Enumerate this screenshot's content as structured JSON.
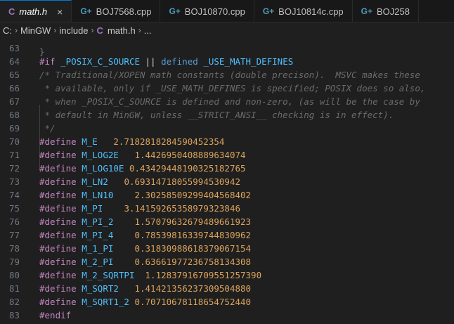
{
  "tabs": [
    {
      "icon": "C",
      "label": "math.h",
      "active": true,
      "close": "×"
    },
    {
      "icon": "G+",
      "label": "BOJ7568.cpp"
    },
    {
      "icon": "G+",
      "label": "BOJ10870.cpp"
    },
    {
      "icon": "G+",
      "label": "BOJ10814c.cpp"
    },
    {
      "icon": "G+",
      "label": "BOJ258"
    }
  ],
  "breadcrumb": {
    "items": [
      "C:",
      "MinGW",
      "include",
      "math.h",
      "..."
    ],
    "file_icon": "C"
  },
  "code": {
    "top_partial": "}",
    "lines": [
      {
        "n": "63",
        "parts": []
      },
      {
        "n": "64",
        "parts": [
          [
            "kw",
            "#if "
          ],
          [
            "mname",
            "_POSIX_C_SOURCE "
          ],
          [
            "op",
            "|| "
          ],
          [
            "mac",
            "defined "
          ],
          [
            "mname",
            "_USE_MATH_DEFINES"
          ]
        ]
      },
      {
        "n": "65",
        "parts": [
          [
            "cmt2",
            "/* Traditional/XOPEN math constants (double precison).  MSVC makes these"
          ]
        ]
      },
      {
        "n": "66",
        "parts": [
          [
            "cmt2",
            " * available, only if _USE_MATH_DEFINES is specified; POSIX does so also,"
          ]
        ]
      },
      {
        "n": "67",
        "parts": [
          [
            "cmt2",
            " * when _POSIX_C_SOURCE is defined and non-zero, (as will be the case by"
          ]
        ]
      },
      {
        "n": "68",
        "parts": [
          [
            "cmt2",
            " * default in MinGW, unless __STRICT_ANSI__ checking is in effect)."
          ]
        ]
      },
      {
        "n": "69",
        "parts": [
          [
            "cmt2",
            " */"
          ]
        ]
      },
      {
        "n": "70",
        "parts": [
          [
            "kw",
            "#define "
          ],
          [
            "mname",
            "M_E   "
          ],
          [
            "numgold",
            "2.7182818284590452354"
          ]
        ]
      },
      {
        "n": "71",
        "parts": [
          [
            "kw",
            "#define "
          ],
          [
            "mname",
            "M_LOG2E   "
          ],
          [
            "numgold",
            "1.4426950408889634074"
          ]
        ]
      },
      {
        "n": "72",
        "parts": [
          [
            "kw",
            "#define "
          ],
          [
            "mname",
            "M_LOG10E "
          ],
          [
            "numgold",
            "0.43429448190325182765"
          ]
        ]
      },
      {
        "n": "73",
        "parts": [
          [
            "kw",
            "#define "
          ],
          [
            "mname",
            "M_LN2   "
          ],
          [
            "numgold",
            "0.69314718055994530942"
          ]
        ]
      },
      {
        "n": "74",
        "parts": [
          [
            "kw",
            "#define "
          ],
          [
            "mname",
            "M_LN10    "
          ],
          [
            "numgold",
            "2.30258509299404568402"
          ]
        ]
      },
      {
        "n": "75",
        "parts": [
          [
            "kw",
            "#define "
          ],
          [
            "mname",
            "M_PI    "
          ],
          [
            "numgold",
            "3.14159265358979323846"
          ]
        ]
      },
      {
        "n": "76",
        "parts": [
          [
            "kw",
            "#define "
          ],
          [
            "mname",
            "M_PI_2    "
          ],
          [
            "numgold",
            "1.57079632679489661923"
          ]
        ]
      },
      {
        "n": "77",
        "parts": [
          [
            "kw",
            "#define "
          ],
          [
            "mname",
            "M_PI_4    "
          ],
          [
            "numgold",
            "0.78539816339744830962"
          ]
        ]
      },
      {
        "n": "78",
        "parts": [
          [
            "kw",
            "#define "
          ],
          [
            "mname",
            "M_1_PI    "
          ],
          [
            "numgold",
            "0.31830988618379067154"
          ]
        ]
      },
      {
        "n": "79",
        "parts": [
          [
            "kw",
            "#define "
          ],
          [
            "mname",
            "M_2_PI    "
          ],
          [
            "numgold",
            "0.63661977236758134308"
          ]
        ]
      },
      {
        "n": "80",
        "parts": [
          [
            "kw",
            "#define "
          ],
          [
            "mname",
            "M_2_SQRTPI  "
          ],
          [
            "numgold",
            "1.12837916709551257390"
          ]
        ]
      },
      {
        "n": "81",
        "parts": [
          [
            "kw",
            "#define "
          ],
          [
            "mname",
            "M_SQRT2   "
          ],
          [
            "numgold",
            "1.41421356237309504880"
          ]
        ]
      },
      {
        "n": "82",
        "parts": [
          [
            "kw",
            "#define "
          ],
          [
            "mname",
            "M_SQRT1_2 "
          ],
          [
            "numgold",
            "0.70710678118654752440"
          ]
        ]
      },
      {
        "n": "83",
        "parts": [
          [
            "kw",
            "#endif"
          ]
        ]
      }
    ]
  }
}
